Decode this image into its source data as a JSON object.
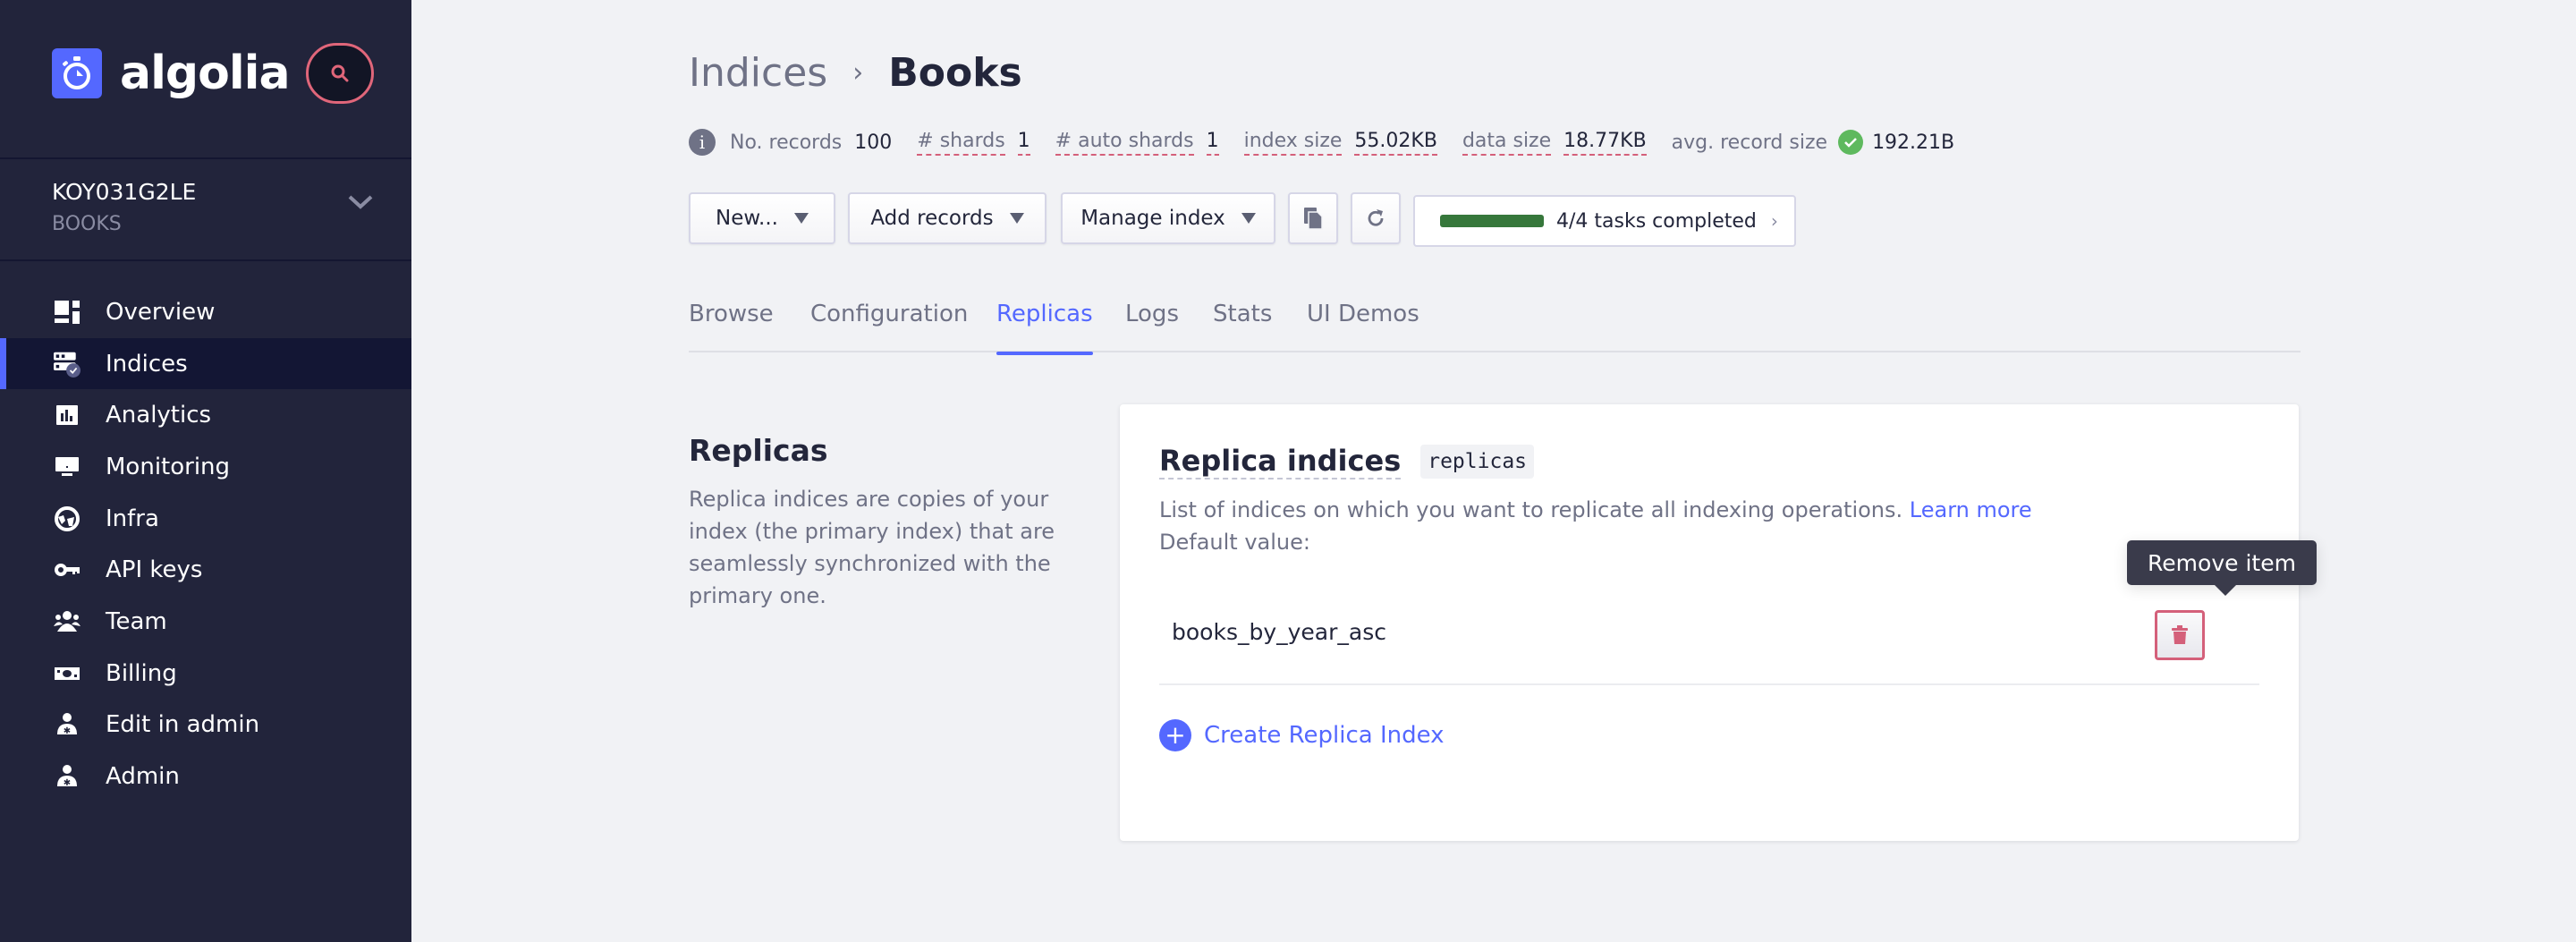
{
  "sidebar": {
    "brand": "algolia",
    "app": {
      "id": "KOY031G2LE",
      "name": "BOOKS"
    },
    "items": [
      {
        "label": "Overview",
        "icon": "overview-icon",
        "active": false
      },
      {
        "label": "Indices",
        "icon": "indices-icon",
        "active": true
      },
      {
        "label": "Analytics",
        "icon": "analytics-icon",
        "active": false
      },
      {
        "label": "Monitoring",
        "icon": "monitoring-icon",
        "active": false
      },
      {
        "label": "Infra",
        "icon": "globe-icon",
        "active": false
      },
      {
        "label": "API keys",
        "icon": "key-icon",
        "active": false
      },
      {
        "label": "Team",
        "icon": "team-icon",
        "active": false
      },
      {
        "label": "Billing",
        "icon": "billing-icon",
        "active": false
      },
      {
        "label": "Edit in admin",
        "icon": "admin-icon",
        "active": false
      },
      {
        "label": "Admin",
        "icon": "admin-icon",
        "active": false
      }
    ]
  },
  "header": {
    "breadcrumb_parent": "Indices",
    "breadcrumb_separator": "›",
    "breadcrumb_current": "Books"
  },
  "stats": {
    "records_label": "No. records",
    "records_value": "100",
    "shards_label": "# shards",
    "shards_value": "1",
    "auto_shards_label": "# auto shards",
    "auto_shards_value": "1",
    "index_size_label": "index size",
    "index_size_value": "55.02KB",
    "data_size_label": "data size",
    "data_size_value": "18.77KB",
    "avg_record_label": "avg. record size",
    "avg_record_value": "192.21B"
  },
  "toolbar": {
    "new_label": "New...",
    "add_records_label": "Add records",
    "manage_index_label": "Manage index",
    "tasks_label": "4/4 tasks completed",
    "tasks_progress": 1.0
  },
  "tabs": [
    {
      "label": "Browse",
      "active": false
    },
    {
      "label": "Configuration",
      "active": false
    },
    {
      "label": "Replicas",
      "active": true
    },
    {
      "label": "Logs",
      "active": false
    },
    {
      "label": "Stats",
      "active": false
    },
    {
      "label": "UI Demos",
      "active": false
    }
  ],
  "section": {
    "title": "Replicas",
    "description": "Replica indices are copies of your index (the primary index) that are seamlessly synchronized with the primary one."
  },
  "card": {
    "title": "Replica indices",
    "param": "replicas",
    "description": "List of indices on which you want to replicate all indexing operations.",
    "learn_more": "Learn more",
    "default_value_label": "Default value:",
    "replicas": [
      "books_by_year_asc"
    ],
    "remove_tooltip": "Remove item",
    "create_label": "Create Replica Index"
  },
  "colors": {
    "accent": "#5468ff",
    "sidebar_bg": "#22243b",
    "danger": "#d4607a",
    "success": "#36773b"
  }
}
